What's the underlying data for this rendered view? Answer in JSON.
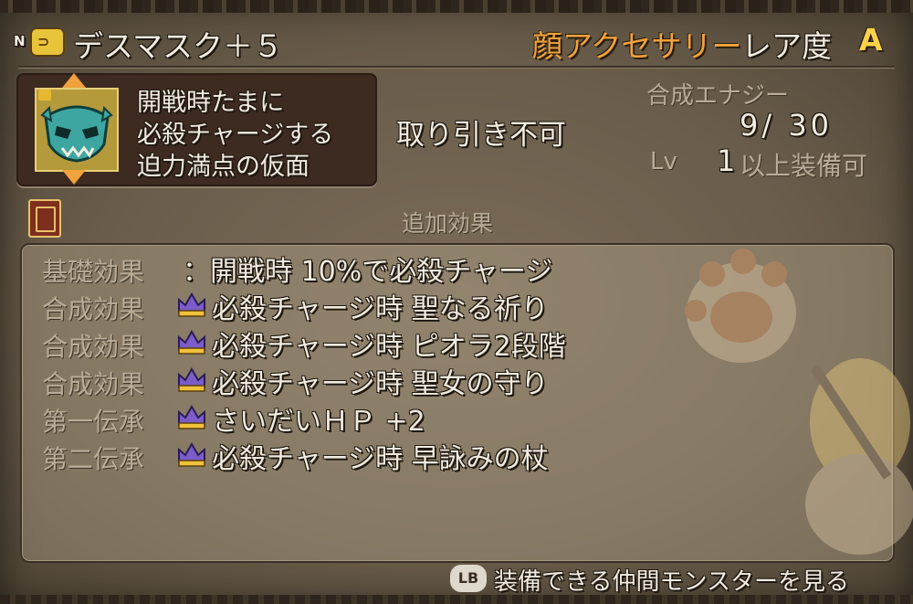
{
  "header": {
    "rank_badge": "N",
    "item_name": "デスマスク＋５",
    "category": "顔アクセサリー",
    "rarity_label": "レア度",
    "rarity_value": "A"
  },
  "item": {
    "description_lines": [
      "開戦時たまに",
      "必殺チャージする",
      "迫力満点の仮面"
    ],
    "trade_status": "取り引き不可",
    "synthesis_label": "合成エナジー",
    "synthesis_value": "9/ 30",
    "level_label": "Lv",
    "level_value": "1",
    "level_suffix": "以上装備可"
  },
  "effects": {
    "section_title": "追加効果",
    "rows": [
      {
        "label": "基礎効果",
        "text": "：開戦時 10%で必殺チャージ",
        "crown": false
      },
      {
        "label": "合成効果",
        "text": "必殺チャージ時 聖なる祈り",
        "crown": true
      },
      {
        "label": "合成効果",
        "text": "必殺チャージ時 ピオラ2段階",
        "crown": true
      },
      {
        "label": "合成効果",
        "text": "必殺チャージ時 聖女の守り",
        "crown": true
      },
      {
        "label": "第一伝承",
        "text": "さいだいＨＰ +2",
        "crown": true
      },
      {
        "label": "第二伝承",
        "text": "必殺チャージ時 早詠みの杖",
        "crown": true
      }
    ]
  },
  "footer": {
    "button": "LB",
    "text": "装備できる仲間モンスターを見る"
  }
}
